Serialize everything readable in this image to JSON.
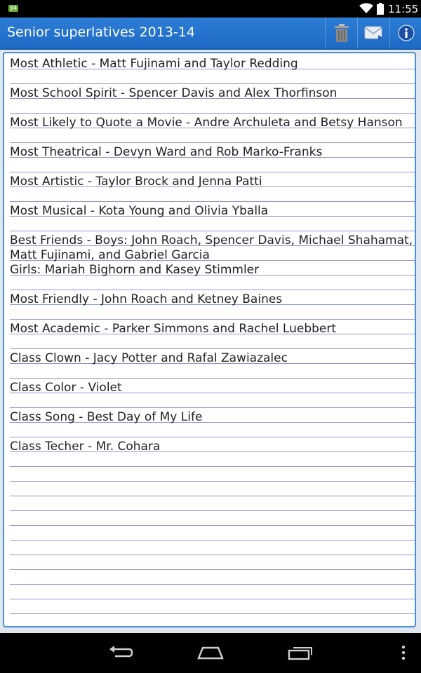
{
  "status_bar": {
    "battery_badge": "94",
    "time": "11:55",
    "icons": [
      "wifi-icon",
      "battery-icon"
    ]
  },
  "action_bar": {
    "title": "Senior superlatives 2013-14",
    "actions": [
      {
        "name": "delete",
        "icon": "trash-icon"
      },
      {
        "name": "email",
        "icon": "mail-icon"
      },
      {
        "name": "info",
        "icon": "info-icon"
      }
    ]
  },
  "note": {
    "lines": [
      "Most Athletic - Matt Fujinami and Taylor Redding",
      "",
      "Most School Spirit - Spencer Davis and Alex Thorfinson",
      "",
      "Most Likely to Quote a Movie - Andre Archuleta and Betsy Hanson",
      "",
      "Most Theatrical - Devyn Ward and Rob Marko-Franks",
      "",
      "Most Artistic - Taylor Brock and Jenna Patti",
      "",
      "Most Musical - Kota Young and Olivia Yballa",
      "",
      "Best Friends - Boys: John Roach, Spencer Davis, Michael Shahamat,",
      "Matt Fujinami, and Gabriel Garcia",
      "Girls: Mariah Bighorn and Kasey Stimmler",
      "",
      "Most Friendly - John Roach and Ketney Baines",
      "",
      "Most Academic - Parker Simmons and Rachel Luebbert",
      "",
      "Class Clown - Jacy Potter and Rafal Zawiazalec",
      "",
      "Class Color - Violet",
      "",
      "Class Song - Best Day of My Life",
      "",
      "Class Techer - Mr. Cohara"
    ]
  },
  "nav_bar": {
    "buttons": [
      "back-icon",
      "home-icon",
      "recent-apps-icon",
      "overflow-menu-icon"
    ]
  },
  "colors": {
    "action_bar": "#2272cf",
    "rule": "#8f95d4",
    "paper_border": "#4a8fd8"
  }
}
